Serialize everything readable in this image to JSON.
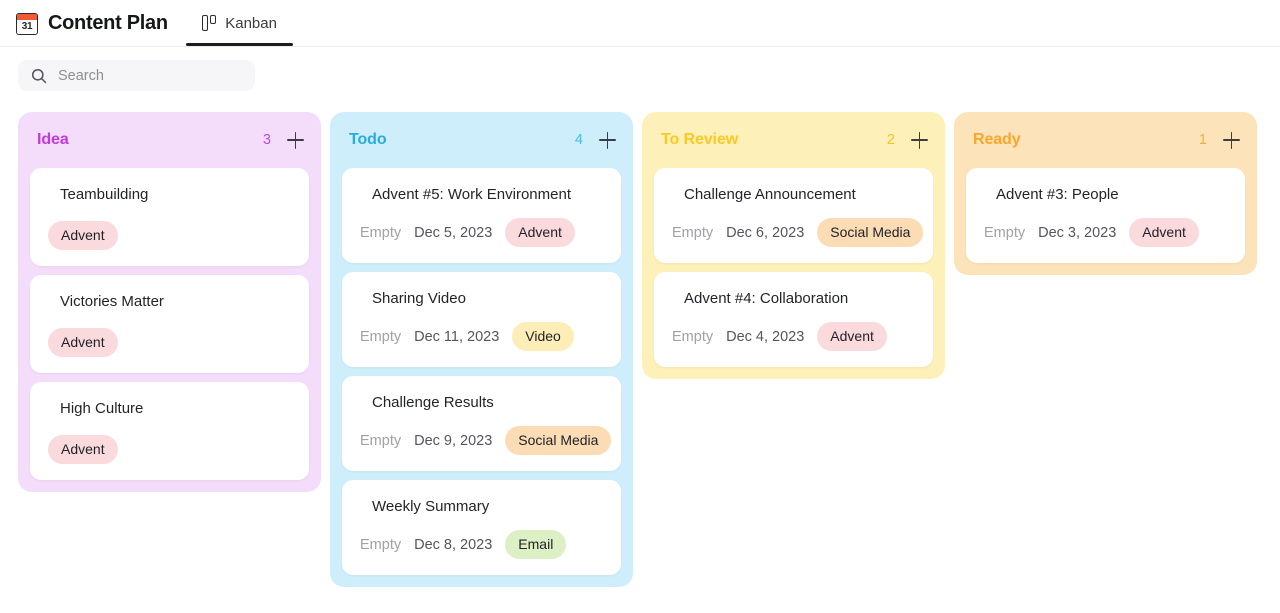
{
  "header": {
    "calendar_icon_day": "31",
    "app_title": "Content Plan",
    "tabs": [
      {
        "label": "Kanban",
        "icon": "kanban-icon",
        "active": true
      }
    ]
  },
  "search": {
    "icon": "search-icon",
    "placeholder": "Search",
    "value": ""
  },
  "tag_colors": {
    "Advent": "#fadadd",
    "Video": "#fdeeb8",
    "Social Media": "#fbdcb4",
    "Email": "#ddefc4"
  },
  "board": {
    "add_icon": "plus-icon",
    "columns": [
      {
        "title": "Idea",
        "count": "3",
        "accent": "#c23bdd",
        "count_color": "#b451d6",
        "background": "#f3ddfb",
        "cards": [
          {
            "title": "Teambuilding",
            "empty": "",
            "date": "",
            "tag": "Advent"
          },
          {
            "title": "Victories Matter",
            "empty": "",
            "date": "",
            "tag": "Advent"
          },
          {
            "title": "High Culture",
            "empty": "",
            "date": "",
            "tag": "Advent"
          }
        ]
      },
      {
        "title": "Todo",
        "count": "4",
        "accent": "#29abe2",
        "count_color": "#4cb8e8",
        "background": "#cfeefb",
        "cards": [
          {
            "title": "Advent #5: Work Environment",
            "empty": "Empty",
            "date": "Dec 5, 2023",
            "tag": "Advent"
          },
          {
            "title": "Sharing Video",
            "empty": "Empty",
            "date": "Dec 11, 2023",
            "tag": "Video"
          },
          {
            "title": "Challenge Results",
            "empty": "Empty",
            "date": "Dec 9, 2023",
            "tag": "Social Media"
          },
          {
            "title": "Weekly Summary",
            "empty": "Empty",
            "date": "Dec 8, 2023",
            "tag": "Email"
          }
        ]
      },
      {
        "title": "To Review",
        "count": "2",
        "accent": "#fbc926",
        "count_color": "#f5c21f",
        "background": "#fdf0b8",
        "cards": [
          {
            "title": "Challenge Announcement",
            "empty": "Empty",
            "date": "Dec 6, 2023",
            "tag": "Social Media"
          },
          {
            "title": "Advent #4: Collaboration",
            "empty": "Empty",
            "date": "Dec 4, 2023",
            "tag": "Advent"
          }
        ]
      },
      {
        "title": "Ready",
        "count": "1",
        "accent": "#faa62a",
        "count_color": "#f5ae3c",
        "background": "#fce3b9",
        "cards": [
          {
            "title": "Advent #3: People",
            "empty": "Empty",
            "date": "Dec 3, 2023",
            "tag": "Advent"
          }
        ]
      }
    ]
  }
}
